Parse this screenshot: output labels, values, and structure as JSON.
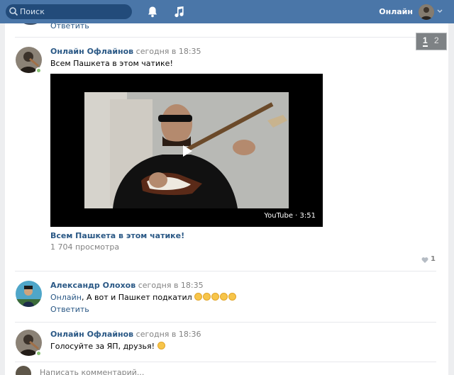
{
  "topbar": {
    "search_placeholder": "Поиск",
    "user_name": "Онлайн",
    "icons": [
      "search-icon",
      "bell-icon",
      "music-icon",
      "chevron-down-icon"
    ]
  },
  "thread": {
    "prev_reply": "Ответить",
    "post": {
      "author": "Онлайн Офлайнов",
      "time": "сегодня в 18:35",
      "text": "Всем Пашкета в этом чатике!",
      "video": {
        "caption": "YouTube · 3:51",
        "title": "Всем Пашкета в этом чатике!",
        "views": "1 704 просмотра"
      },
      "likes": "1"
    },
    "reply": {
      "author": "Александр Олохов",
      "time": "сегодня в 18:35",
      "mention": "Онлайн",
      "text": ", А вот и Пашкет подкатил ",
      "emoji_count": 5,
      "reply_label": "Ответить"
    },
    "last": {
      "author": "Онлайн Офлайнов",
      "time": "сегодня в 18:36",
      "text": "Голосуйте за ЯП, друзья! "
    },
    "composer_placeholder": "Написать комментарий..."
  },
  "pager": {
    "page1": "1",
    "page2": "2",
    "current": 1
  },
  "colors": {
    "accent": "#4a76a8",
    "link": "#2a5885",
    "online": "#8ac176"
  }
}
